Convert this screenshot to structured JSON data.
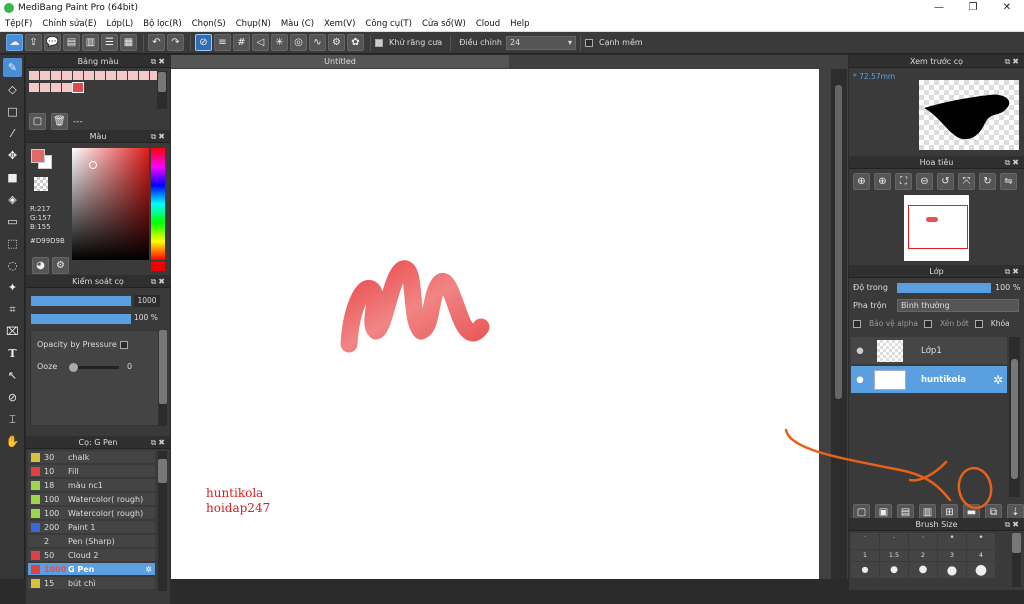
{
  "window": {
    "title": "MediBang Paint Pro (64bit)",
    "minimize": "—",
    "maximize": "❐",
    "close": "✕"
  },
  "menu": [
    "Tệp(F)",
    "Chỉnh sửa(E)",
    "Lớp(L)",
    "Bộ lọc(R)",
    "Chọn(S)",
    "Chụp(N)",
    "Màu (C)",
    "Xem(V)",
    "Công cụ(T)",
    "Cửa sổ(W)",
    "Cloud",
    "Help"
  ],
  "toolbar": {
    "antialias_label": "Khử răng cưa",
    "adjust_label": "Điều chỉnh",
    "adjust_value": "24",
    "smooth_label": "Cạnh mềm"
  },
  "panels": {
    "palette_title": "Bảng màu",
    "palette_placeholder": "---",
    "color_title": "Màu",
    "color_r": "R:217",
    "color_g": "G:157",
    "color_b": "B:155",
    "color_hex": "#D99D9B",
    "brush_ctrl_title": "Kiểm soát cọ",
    "brush_size_value": "1000",
    "brush_opacity_value": "100 %",
    "opacity_pressure_label": "Opacity by Pressure",
    "ooze_label": "Ooze",
    "ooze_value": "0",
    "brush_list_title": "Cọ: G Pen"
  },
  "brushes": [
    {
      "size": "30",
      "name": "chalk",
      "color": "#d8c13a"
    },
    {
      "size": "10",
      "name": "Fill",
      "color": "#e04040"
    },
    {
      "size": "18",
      "name": "màu nc1",
      "color": "#9dd64a"
    },
    {
      "size": "100",
      "name": "Watercolor( rough)",
      "color": "#9dd64a"
    },
    {
      "size": "100",
      "name": "Watercolor( rough)",
      "color": "#9dd64a"
    },
    {
      "size": "200",
      "name": "Paint 1",
      "color": "#3a6ad8"
    },
    {
      "size": "2",
      "name": "Pen (Sharp)",
      "color": "#444444"
    },
    {
      "size": "50",
      "name": "Cloud 2",
      "color": "#e04040"
    },
    {
      "size": "1000",
      "name": "G Pen",
      "color": "#e04040"
    },
    {
      "size": "15",
      "name": "bút chì",
      "color": "#d8c13a"
    }
  ],
  "document": {
    "tab": "Untitled",
    "text_line1": "huntikola",
    "text_line2": "hoidap247"
  },
  "right": {
    "preview_title": "Xem trước cọ",
    "preview_size": "72.57mm",
    "nav_title": "Hoa tiêu",
    "layer_title": "Lớp",
    "opacity_label": "Độ trong",
    "opacity_value": "100 %",
    "blend_label": "Pha trộn",
    "blend_value": "Bình thường",
    "protect_alpha": "Bảo vệ alpha",
    "clip": "Xén bớt",
    "lock": "Khóa",
    "brush_size_title": "Brush Size"
  },
  "layers": [
    {
      "name": "Lớp1",
      "selected": false
    },
    {
      "name": "huntikola",
      "selected": true
    }
  ],
  "brush_sizes": [
    "1",
    "1.5",
    "2",
    "3",
    "4"
  ],
  "colors": {
    "accent": "#4a8fd6",
    "selected_row": "#5aa0e0",
    "annotation": "#e8611a"
  }
}
